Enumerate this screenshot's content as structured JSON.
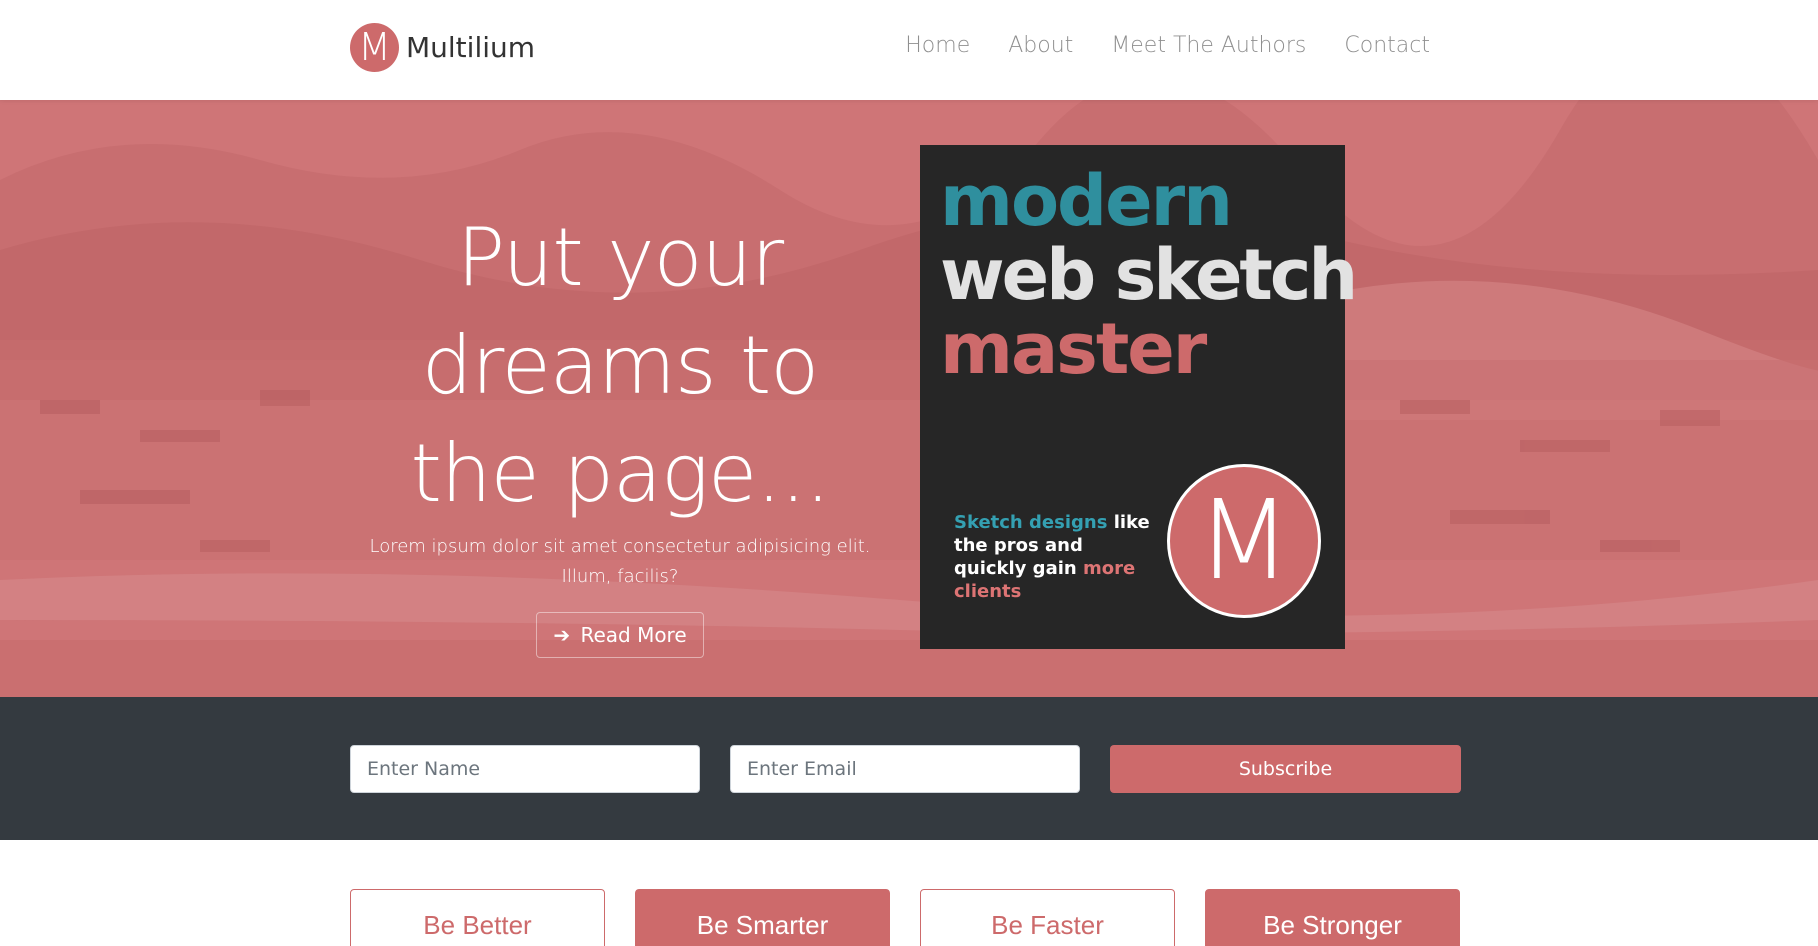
{
  "brand": {
    "logo_letter": "M",
    "name": "Multilium"
  },
  "nav": {
    "items": [
      "Home",
      "About",
      "Meet The Authors",
      "Contact"
    ]
  },
  "hero": {
    "title": "Put your dreams to the page...",
    "subtitle": "Lorem ipsum dolor sit amet consectetur adipisicing elit. Illum, facilis?",
    "button_label": "Read More",
    "button_icon": "arrow-right-icon"
  },
  "book": {
    "line1": "modern",
    "line2": "web sketch",
    "line3": "master",
    "tagline": {
      "part1": "Sketch designs",
      "part2": "like the pros and quickly gain",
      "part3": "more clients"
    },
    "badge_letter": "M"
  },
  "subscribe": {
    "name_placeholder": "Enter Name",
    "email_placeholder": "Enter Email",
    "button_label": "Subscribe"
  },
  "features": [
    "Be Better",
    "Be Smarter",
    "Be Faster",
    "Be Stronger"
  ],
  "colors": {
    "accent": "#cd6a6b",
    "dark": "#343a40",
    "book_bg": "#262626",
    "teal": "#2f8f9e",
    "nav_text": "#8f8f8f"
  }
}
